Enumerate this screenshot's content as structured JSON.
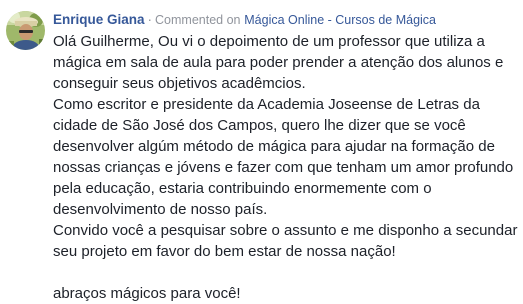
{
  "comment": {
    "author": "Enrique Giana",
    "separator": "·",
    "action_text": "Commented on",
    "page_name": "Mágica Online - Cursos de Mágica",
    "paragraphs": [
      "Olá Guilherme, Ou vi o depoimento de um professor que utiliza a mágica em sala de aula para poder prender a atenção dos alunos e conseguir seus objetivos acadêmcios.",
      "Como escritor e presidente da Academia Joseense de Letras da cidade de São José dos Campos, quero lhe dizer que se você desenvolver algúm método de mágica para ajudar na formação de nossas crianças e jóvens e fazer com que tenham um amor profundo pela educação, estaria contribuindo enormemente com o desenvolvimento de nosso país.",
      "Convido você a pesquisar sobre o assunto e me disponho a secundar seu projeto em favor do bem estar de nossa nação!",
      "abraços mágicos para você!"
    ],
    "avatar_icon": "user-avatar-photo"
  }
}
